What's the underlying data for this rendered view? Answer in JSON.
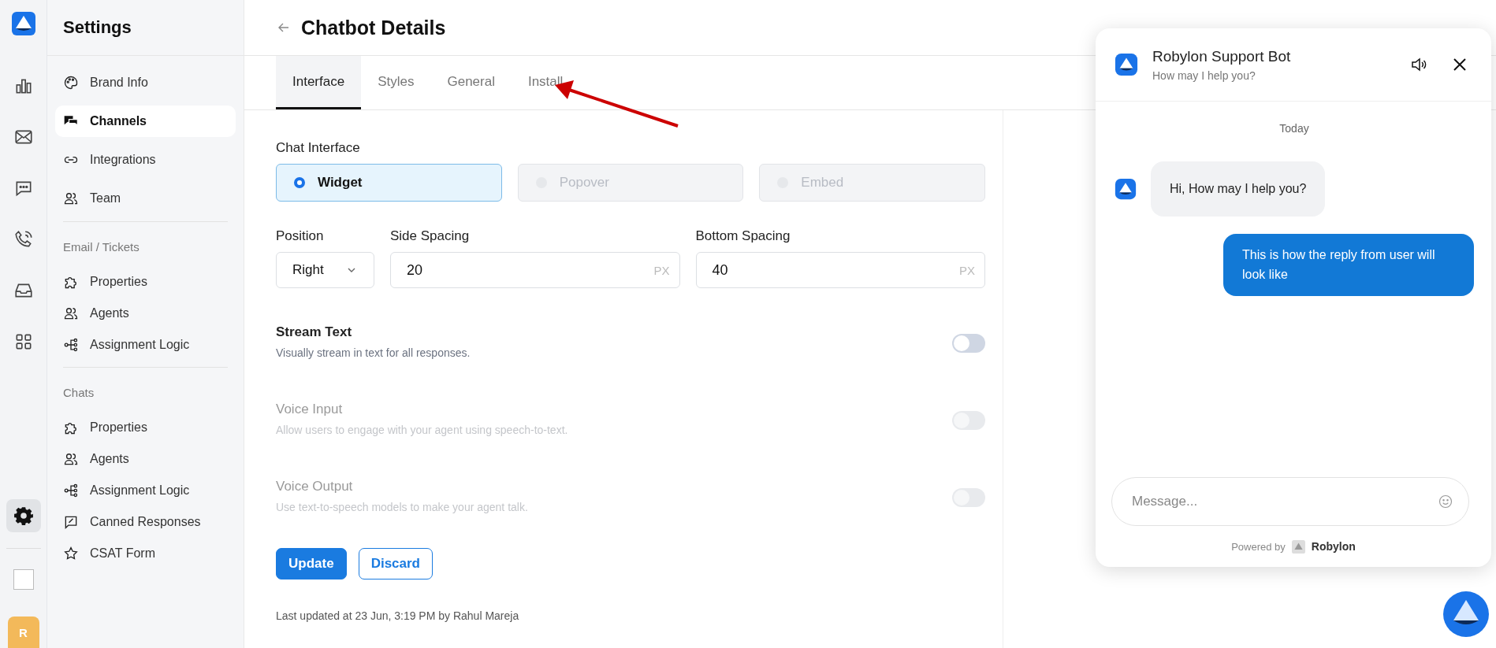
{
  "rail": {
    "items": [
      {
        "kind": "chart",
        "selected": false
      },
      {
        "kind": "mail",
        "selected": false
      },
      {
        "kind": "chat",
        "selected": false
      },
      {
        "kind": "phone",
        "selected": false
      },
      {
        "kind": "inbox",
        "selected": false
      },
      {
        "kind": "grid",
        "selected": false
      }
    ],
    "settings_item": {
      "kind": "gear",
      "selected": true
    },
    "avatar": "R"
  },
  "sidebar": {
    "title": "Settings",
    "sections": [
      {
        "items": [
          {
            "label": "Brand Info",
            "kind": "palette",
            "selected": false
          },
          {
            "label": "Channels",
            "kind": "channels",
            "selected": true
          },
          {
            "label": "Integrations",
            "kind": "link",
            "selected": false
          },
          {
            "label": "Team",
            "kind": "users",
            "selected": false
          }
        ]
      },
      {
        "heading": "Email / Tickets",
        "items": [
          {
            "label": "Properties",
            "kind": "puzzle",
            "selected": false
          },
          {
            "label": "Agents",
            "kind": "users",
            "selected": false
          },
          {
            "label": "Assignment Logic",
            "kind": "flow",
            "selected": false
          }
        ]
      },
      {
        "heading": "Chats",
        "items": [
          {
            "label": "Properties",
            "kind": "puzzle",
            "selected": false
          },
          {
            "label": "Agents",
            "kind": "users",
            "selected": false
          },
          {
            "label": "Assignment Logic",
            "kind": "flow",
            "selected": false
          },
          {
            "label": "Canned Responses",
            "kind": "canned",
            "selected": false
          },
          {
            "label": "CSAT Form",
            "kind": "star",
            "selected": false
          }
        ]
      }
    ]
  },
  "page": {
    "title": "Chatbot Details"
  },
  "tabs": [
    {
      "label": "Interface",
      "selected": true
    },
    {
      "label": "Styles",
      "selected": false
    },
    {
      "label": "General",
      "selected": false
    },
    {
      "label": "Install",
      "selected": false
    }
  ],
  "chat_interface": {
    "label": "Chat Interface",
    "options": [
      {
        "label": "Widget",
        "selected": true,
        "disabled": false
      },
      {
        "label": "Popover",
        "selected": false,
        "disabled": true
      },
      {
        "label": "Embed",
        "selected": false,
        "disabled": true
      }
    ]
  },
  "position": {
    "label": "Position",
    "value": "Right"
  },
  "side_spacing": {
    "label": "Side Spacing",
    "value": "20",
    "unit": "PX"
  },
  "bottom_spacing": {
    "label": "Bottom Spacing",
    "value": "40",
    "unit": "PX"
  },
  "settings": [
    {
      "title": "Stream Text",
      "description": "Visually stream in text for all responses.",
      "on": false,
      "disabled": false
    },
    {
      "title": "Voice Input",
      "description": "Allow users to engage with your agent using speech-to-text.",
      "on": false,
      "disabled": true
    },
    {
      "title": "Voice Output",
      "description": "Use text-to-speech models to make your agent talk.",
      "on": false,
      "disabled": true
    }
  ],
  "buttons": [
    {
      "label": "Update",
      "kind": "primary"
    },
    {
      "label": "Discard",
      "kind": "outline"
    }
  ],
  "last_updated": "Last updated at 23 Jun, 3:19 PM by Rahul Mareja",
  "chat_preview": {
    "title": "Robylon Support Bot",
    "subtitle": "How may I help you?",
    "date": "Today",
    "messages": [
      {
        "kind": "bot",
        "text": "Hi, How may I help you?"
      },
      {
        "kind": "user",
        "text": "This is how the reply from user will look like"
      }
    ],
    "input": {
      "placeholder": "Message..."
    },
    "powered_by": "Powered by",
    "brand": "Robylon"
  }
}
